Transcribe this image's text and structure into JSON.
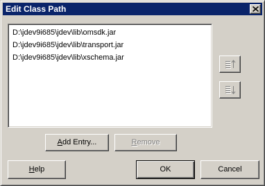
{
  "window": {
    "title": "Edit Class Path"
  },
  "class_path": {
    "entries": [
      "D:\\jdev9i685\\jdev\\lib\\omsdk.jar",
      "D:\\jdev9i685\\jdev\\lib\\transport.jar",
      "D:\\jdev9i685\\jdev\\lib\\xschema.jar"
    ]
  },
  "list_buttons": {
    "move_up_icon": "move-up-icon",
    "move_down_icon": "move-down-icon"
  },
  "actions": {
    "add_entry_label": "Add Entry...",
    "add_entry_mnemonic": "A",
    "add_entry_rest": "dd Entry...",
    "remove_label": "Remove",
    "remove_mnemonic": "R",
    "remove_rest": "emove"
  },
  "footer": {
    "help_label": "Help",
    "help_mnemonic": "H",
    "help_rest": "elp",
    "ok_label": "OK",
    "cancel_label": "Cancel"
  },
  "colors": {
    "title_bar": "#0a246a",
    "face": "#d4d0c8",
    "disabled_text": "#808080"
  }
}
